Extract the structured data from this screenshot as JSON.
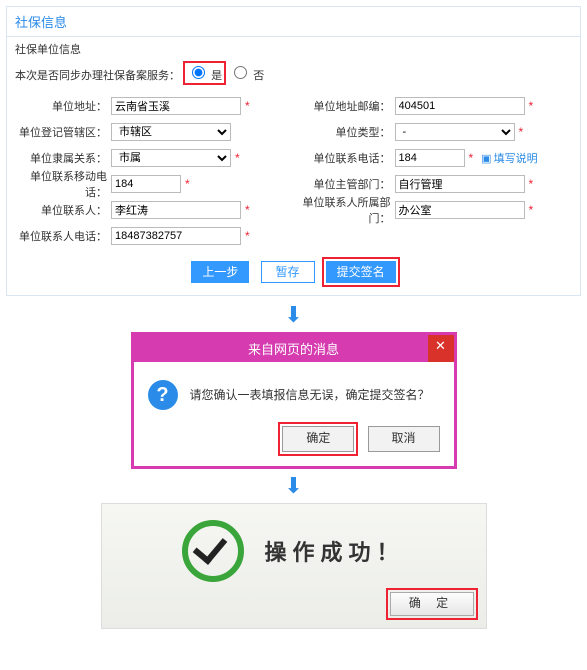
{
  "panel": {
    "title": "社保信息",
    "subtitle": "社保单位信息",
    "radio_label": "本次是否同步办理社保备案服务：",
    "radio_yes": "是",
    "radio_no": "否",
    "fields": {
      "addr_label": "单位地址：",
      "addr_value": "云南省玉溪",
      "zip_label": "单位地址邮编：",
      "zip_value": "404501",
      "region_label": "单位登记管辖区：",
      "region_value": "市辖区",
      "type_label": "单位类型：",
      "type_value": "-",
      "belong_label": "单位隶属关系：",
      "belong_value": "市属",
      "tel_label": "单位联系电话：",
      "tel_value": "184",
      "tel_link": "填写说明",
      "mobile_label": "单位联系移动电话：",
      "mobile_value": "184",
      "dept_label": "单位主管部门：",
      "dept_value": "自行管理",
      "contact_label": "单位联系人：",
      "contact_value": "李红涛",
      "contact_dept_label": "单位联系人所属部门：",
      "contact_dept_value": "办公室",
      "contact_tel_label": "单位联系人电话：",
      "contact_tel_value": "18487382757"
    },
    "buttons": {
      "prev": "上一步",
      "save": "暂存",
      "submit": "提交签名"
    }
  },
  "dialog": {
    "title": "来自网页的消息",
    "message": "请您确认一表填报信息无误，确定提交签名？",
    "ok": "确定",
    "cancel": "取消"
  },
  "success": {
    "text": "操作成功！",
    "ok": "确 定"
  }
}
